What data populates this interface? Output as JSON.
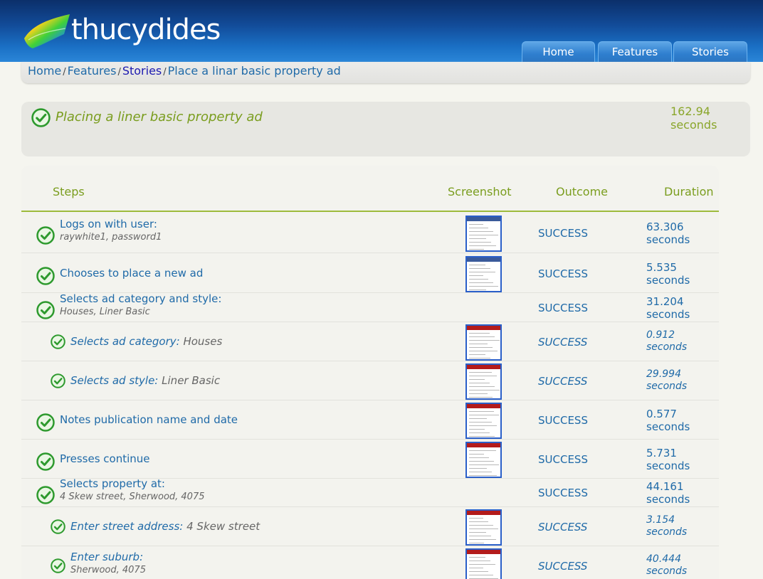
{
  "header": {
    "brand": "thucydides",
    "tabs": [
      "Home",
      "Features",
      "Stories"
    ]
  },
  "breadcrumb": {
    "items": [
      "Home",
      "Features",
      "Stories",
      "Place a linar basic property ad"
    ],
    "separator": "/"
  },
  "story": {
    "title": "Placing a liner basic property ad",
    "duration_value": "162.94",
    "duration_unit": "seconds"
  },
  "columns": {
    "steps": "Steps",
    "screenshot": "Screenshot",
    "outcome": "Outcome",
    "duration": "Duration"
  },
  "steps": [
    {
      "label": "Logs on with user:",
      "params": "raywhite1, password1",
      "outcome": "SUCCESS",
      "duration_value": "63.306",
      "duration_unit": "seconds",
      "has_screenshot": true
    },
    {
      "label": "Chooses to place a new ad",
      "params": "",
      "outcome": "SUCCESS",
      "duration_value": "5.535",
      "duration_unit": "seconds",
      "has_screenshot": true
    },
    {
      "label": "Selects ad category and style:",
      "params": "Houses, Liner Basic",
      "outcome": "SUCCESS",
      "duration_value": "31.204",
      "duration_unit": "seconds",
      "has_screenshot": false
    },
    {
      "label": "Selects ad category:",
      "params": "Houses",
      "outcome": "SUCCESS",
      "duration_value": "0.912",
      "duration_unit": "seconds",
      "has_screenshot": true,
      "nested": true
    },
    {
      "label": "Selects ad style:",
      "params": "Liner Basic",
      "outcome": "SUCCESS",
      "duration_value": "29.994",
      "duration_unit": "seconds",
      "has_screenshot": true,
      "nested": true
    },
    {
      "label": "Notes publication name and date",
      "params": "",
      "outcome": "SUCCESS",
      "duration_value": "0.577",
      "duration_unit": "seconds",
      "has_screenshot": true
    },
    {
      "label": "Presses continue",
      "params": "",
      "outcome": "SUCCESS",
      "duration_value": "5.731",
      "duration_unit": "seconds",
      "has_screenshot": true
    },
    {
      "label": "Selects property at:",
      "params": "4 Skew street, Sherwood, 4075",
      "outcome": "SUCCESS",
      "duration_value": "44.161",
      "duration_unit": "seconds",
      "has_screenshot": false
    },
    {
      "label": "Enter street address:",
      "params": "4 Skew street",
      "outcome": "SUCCESS",
      "duration_value": "3.154",
      "duration_unit": "seconds",
      "has_screenshot": true,
      "nested": true
    },
    {
      "label": "Enter suburb:",
      "params": "Sherwood, 4075",
      "outcome": "SUCCESS",
      "duration_value": "40.444",
      "duration_unit": "seconds",
      "has_screenshot": true,
      "nested": true
    }
  ],
  "colors": {
    "link": "#1f6aa8",
    "success_green": "#2e9a2e",
    "accent_olive": "#7a9d1e",
    "header_blue": "#124b98"
  },
  "icons": {
    "status": "success-check-icon",
    "logo": "thucydides-logo-icon"
  }
}
